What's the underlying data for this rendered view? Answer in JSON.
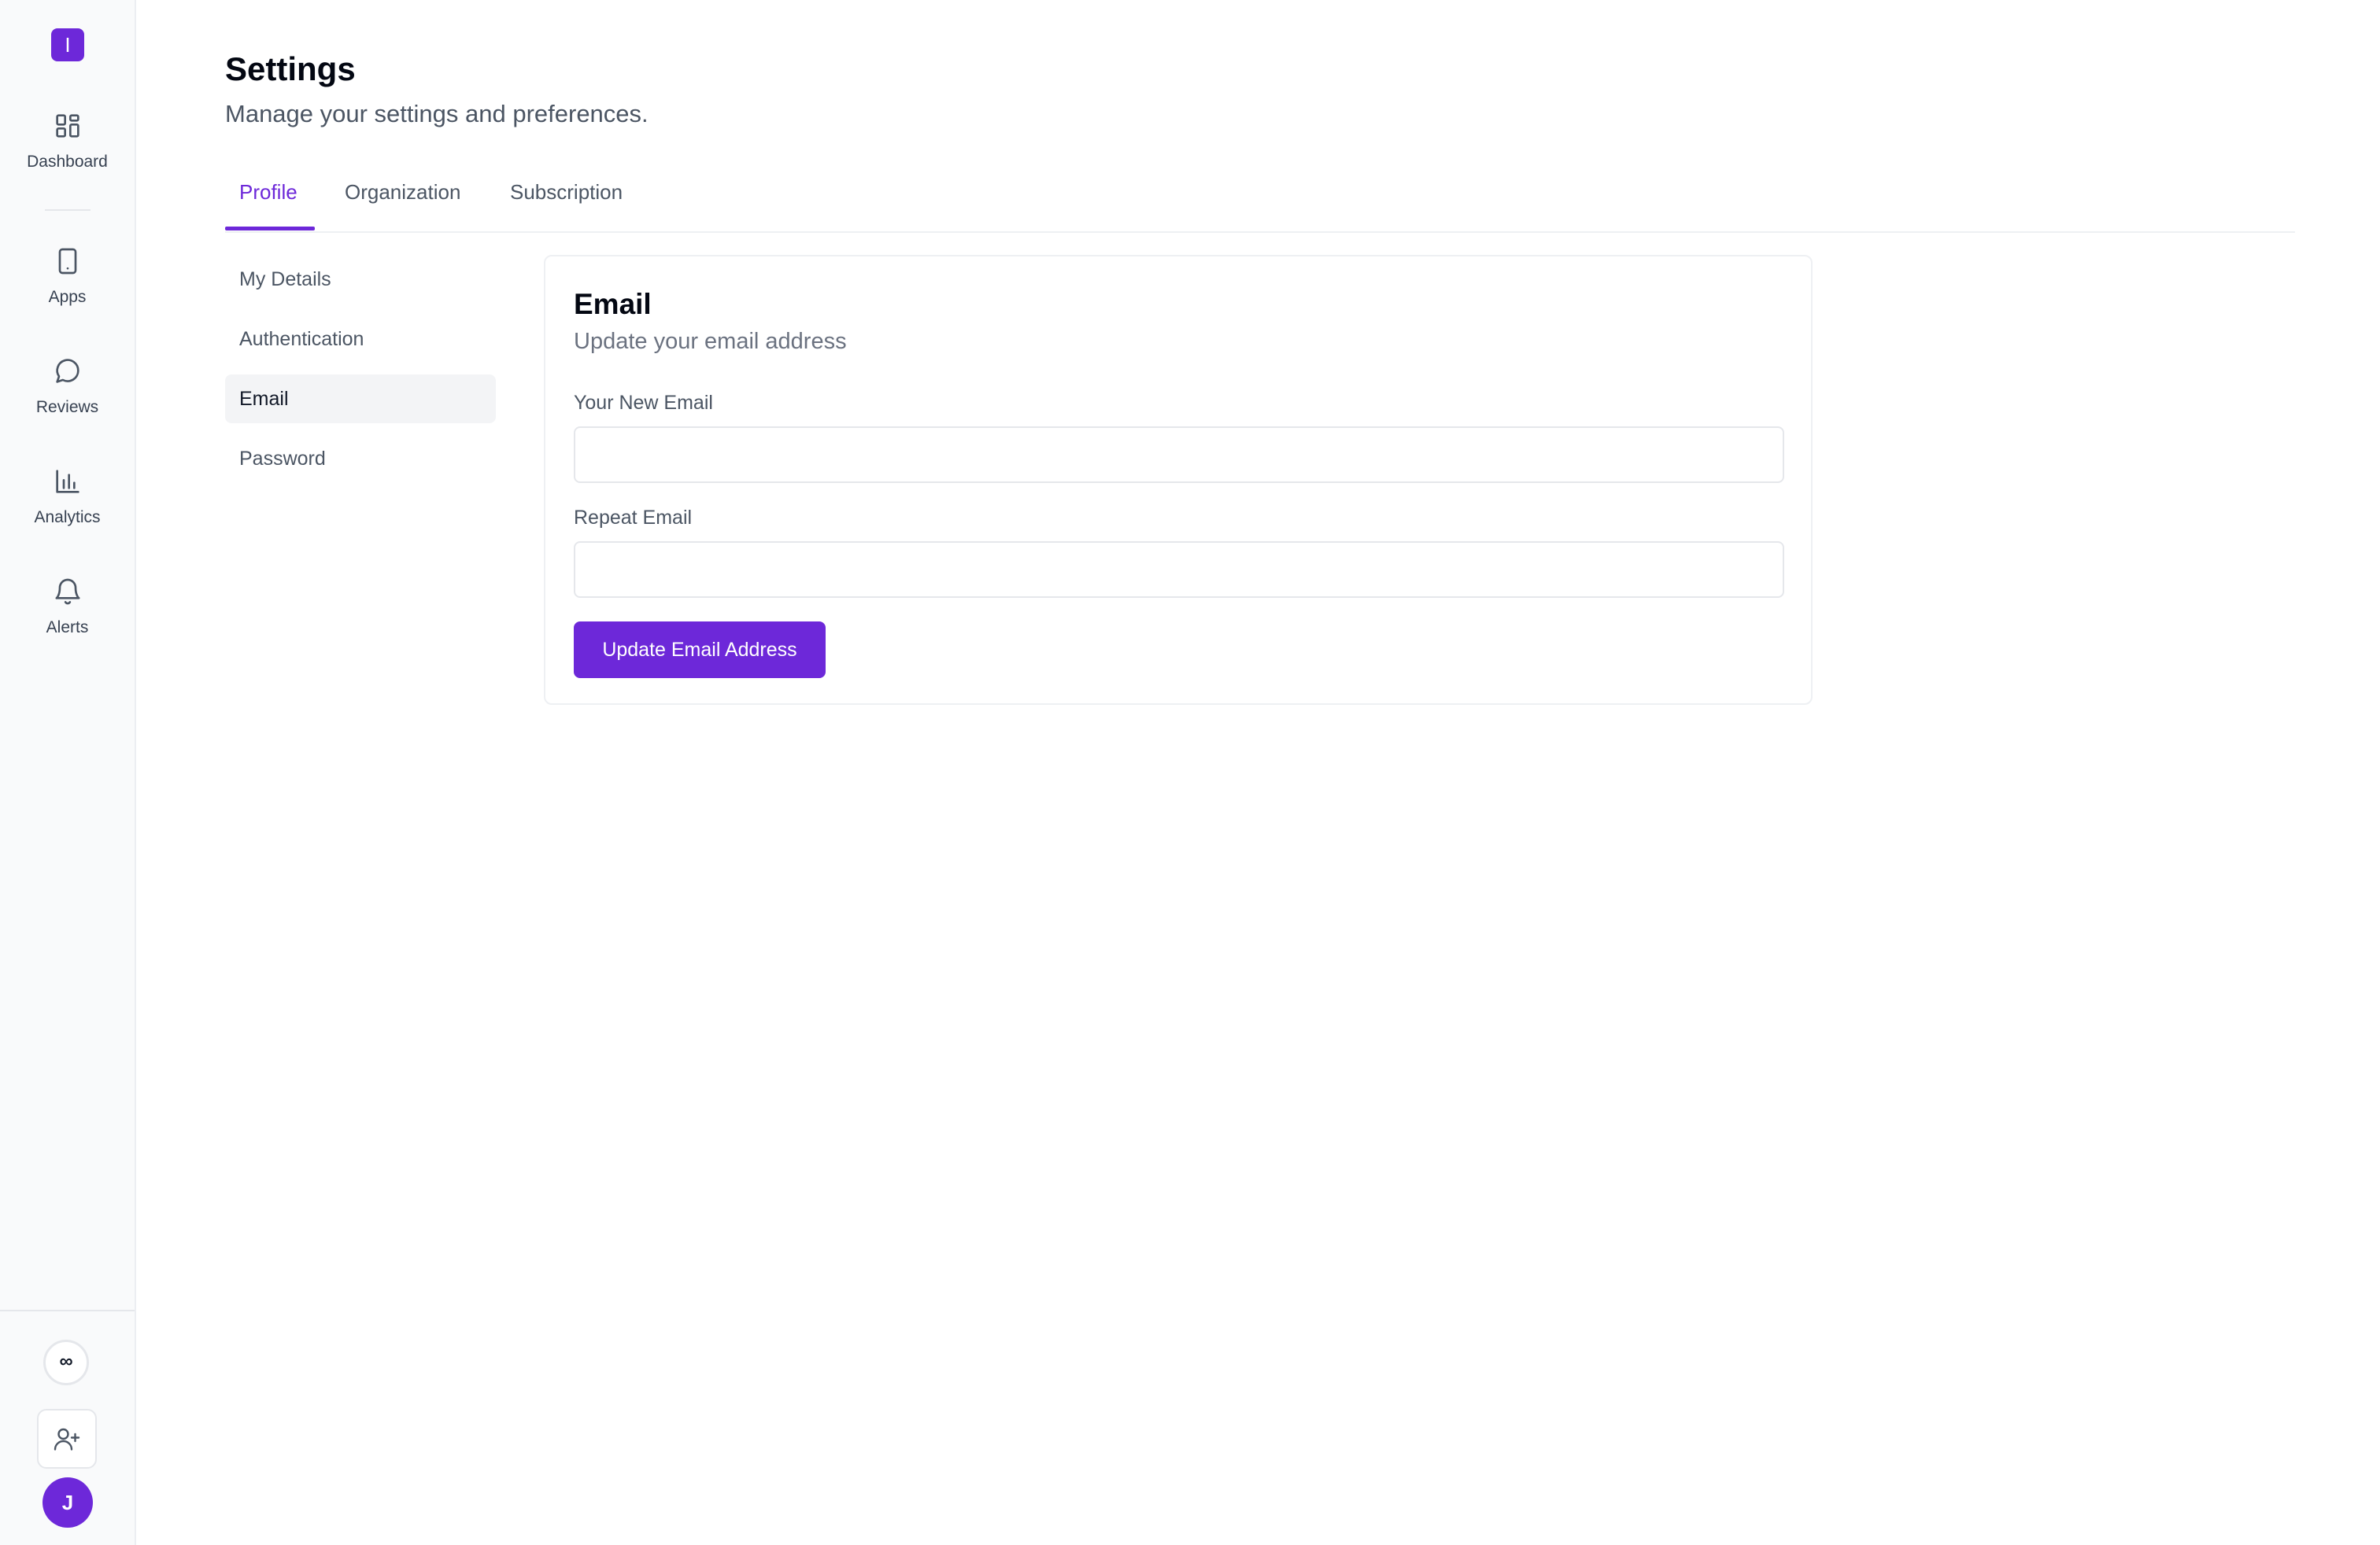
{
  "sidebar": {
    "logo_letter": "I",
    "nav": [
      {
        "label": "Dashboard",
        "icon": "dashboard-grid-icon"
      },
      {
        "label": "Apps",
        "icon": "mobile-device-icon"
      },
      {
        "label": "Reviews",
        "icon": "chat-bubble-icon"
      },
      {
        "label": "Analytics",
        "icon": "bar-chart-icon"
      },
      {
        "label": "Alerts",
        "icon": "bell-icon"
      }
    ],
    "bottom": {
      "infinity_symbol": "∞",
      "invite_icon": "user-plus-icon",
      "avatar_initial": "J"
    }
  },
  "header": {
    "title": "Settings",
    "subtitle": "Manage your settings and preferences."
  },
  "tabs": [
    {
      "label": "Profile",
      "active": true
    },
    {
      "label": "Organization",
      "active": false
    },
    {
      "label": "Subscription",
      "active": false
    }
  ],
  "side_menu": [
    {
      "label": "My Details",
      "active": false
    },
    {
      "label": "Authentication",
      "active": false
    },
    {
      "label": "Email",
      "active": true
    },
    {
      "label": "Password",
      "active": false
    }
  ],
  "email_card": {
    "title": "Email",
    "subtitle": "Update your email address",
    "new_email_label": "Your New Email",
    "new_email_value": "",
    "repeat_email_label": "Repeat Email",
    "repeat_email_value": "",
    "submit_label": "Update Email Address"
  },
  "colors": {
    "accent": "#6d28d9",
    "sidebar_bg": "#f9fafb",
    "border": "#e5e7eb",
    "muted_text": "#4b5563"
  }
}
